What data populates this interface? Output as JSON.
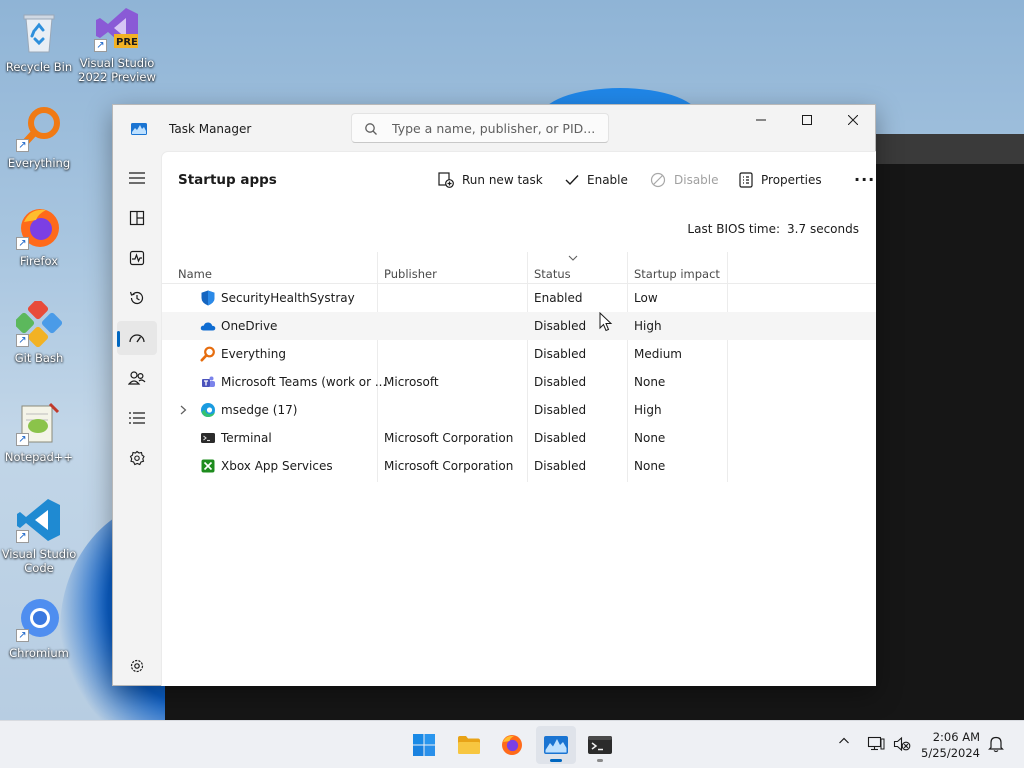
{
  "desktop": {
    "icons": [
      {
        "label": "Recycle Bin",
        "icon": "recycle-bin-icon"
      },
      {
        "label": "Visual Studio 2022 Preview",
        "icon": "visual-studio-icon",
        "badge": "PRE"
      },
      {
        "label": "Everything",
        "icon": "everything-search-icon"
      },
      {
        "label": "Firefox",
        "icon": "firefox-icon"
      },
      {
        "label": "Git Bash",
        "icon": "git-bash-icon"
      },
      {
        "label": "Notepad++",
        "icon": "notepadpp-icon"
      },
      {
        "label": "Visual Studio Code",
        "icon": "vscode-icon"
      },
      {
        "label": "Chromium",
        "icon": "chromium-icon"
      }
    ],
    "shortcut_glyph": "↗"
  },
  "window": {
    "title": "Task Manager",
    "search_placeholder": "Type a name, publisher, or PID...",
    "accent": "#0067c0"
  },
  "nav": {
    "items": [
      {
        "name": "hamburger-icon"
      },
      {
        "name": "processes-icon"
      },
      {
        "name": "performance-icon"
      },
      {
        "name": "app-history-icon"
      },
      {
        "name": "startup-apps-icon",
        "active": true
      },
      {
        "name": "users-icon"
      },
      {
        "name": "details-icon"
      },
      {
        "name": "services-icon"
      },
      {
        "name": "settings-icon"
      }
    ]
  },
  "page": {
    "title": "Startup apps",
    "toolbar": {
      "run_new_task": "Run new task",
      "enable": "Enable",
      "disable": "Disable",
      "properties": "Properties",
      "more": "..."
    },
    "bios_label": "Last BIOS time:",
    "bios_value": "3.7 seconds"
  },
  "table": {
    "columns": {
      "name": "Name",
      "publisher": "Publisher",
      "status": "Status",
      "impact": "Startup impact"
    },
    "rows": [
      {
        "name": "SecurityHealthSystray",
        "publisher": "",
        "status": "Enabled",
        "impact": "Low",
        "icon": "windows-security-shield-icon"
      },
      {
        "name": "OneDrive",
        "publisher": "",
        "status": "Disabled",
        "impact": "High",
        "icon": "onedrive-cloud-icon"
      },
      {
        "name": "Everything",
        "publisher": "",
        "status": "Disabled",
        "impact": "Medium",
        "icon": "everything-search-icon"
      },
      {
        "name": "Microsoft Teams (work or ...",
        "publisher": "Microsoft",
        "status": "Disabled",
        "impact": "None",
        "icon": "teams-icon"
      },
      {
        "name": "msedge (17)",
        "publisher": "",
        "status": "Disabled",
        "impact": "High",
        "icon": "edge-icon",
        "expandable": true
      },
      {
        "name": "Terminal",
        "publisher": "Microsoft Corporation",
        "status": "Disabled",
        "impact": "None",
        "icon": "terminal-icon"
      },
      {
        "name": "Xbox App Services",
        "publisher": "Microsoft Corporation",
        "status": "Disabled",
        "impact": "None",
        "icon": "xbox-icon"
      }
    ]
  },
  "taskbar": {
    "apps": [
      {
        "name": "start-button"
      },
      {
        "name": "file-explorer-button"
      },
      {
        "name": "firefox-button"
      },
      {
        "name": "task-manager-button",
        "active": true
      },
      {
        "name": "terminal-button",
        "running": true
      }
    ],
    "clock": {
      "time": "2:06 AM",
      "date": "5/25/2024"
    }
  }
}
